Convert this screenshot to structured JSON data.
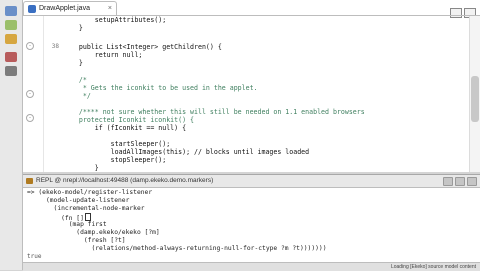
{
  "editor": {
    "tab_title": "DrawApplet.java",
    "tab_close": "×",
    "lines": [
      {
        "t": "        setupAttributes();",
        "s": ""
      },
      {
        "t": "    }",
        "s": ""
      },
      {
        "t": "",
        "s": ""
      },
      {
        "t": "    public List<Integer> getChildren() {",
        "s": ""
      },
      {
        "t": "        return null;",
        "s": ""
      },
      {
        "t": "    }",
        "s": ""
      },
      {
        "t": "",
        "s": ""
      },
      {
        "t": "    /*",
        "s": "c"
      },
      {
        "t": "     * Gets the iconkit to be used in the applet.",
        "s": "c"
      },
      {
        "t": "     */",
        "s": "c"
      },
      {
        "t": "",
        "s": ""
      },
      {
        "t": "    /**** not sure whether this will still be needed on 1.1 enabled browsers",
        "s": "c"
      },
      {
        "t": "    protected Iconkit iconkit() {",
        "s": "c"
      },
      {
        "t": "        if (fIconkit == null) {",
        "s": ""
      },
      {
        "t": "",
        "s": ""
      },
      {
        "t": "            startSleeper();",
        "s": ""
      },
      {
        "t": "            loadAllImages(this); // blocks until images loaded",
        "s": ""
      },
      {
        "t": "            stopSleeper();",
        "s": ""
      },
      {
        "t": "        }",
        "s": ""
      }
    ],
    "line_numbers": [
      "",
      "",
      "",
      "",
      "",
      "",
      "",
      "",
      "",
      "",
      "",
      "",
      "",
      "",
      "",
      "",
      "",
      "",
      ""
    ],
    "gutter_number": "38"
  },
  "repl": {
    "title": "REPL @ nrepl://localhost:49488 (damp.ekeko.demo.markers)",
    "lines": [
      "=> (ekeko-model/register-listener",
      "     (model-update-listener",
      "       (incremental-node-marker",
      "         (fn []",
      "           (map first",
      "             (damp.ekeko/ekeko [?m]",
      "               (fresh [?t]",
      "                 (relations/method-always-returning-null-for-ctype ?m ?t)))))))",
      ""
    ],
    "prompt": "true"
  },
  "status": {
    "text": "Loading [Ekeko] source model content"
  }
}
